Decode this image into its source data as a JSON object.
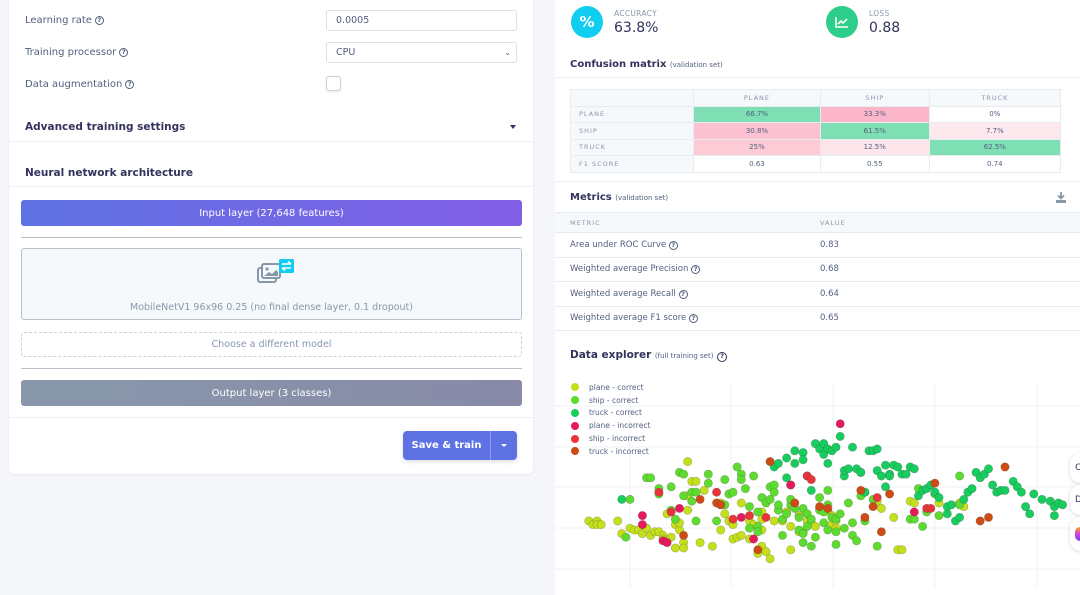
{
  "training_settings": {
    "learning_rate": {
      "label": "Learning rate",
      "value": "0.0005"
    },
    "training_processor": {
      "label": "Training processor",
      "value": "CPU"
    },
    "data_augmentation": {
      "label": "Data augmentation",
      "checked": false
    },
    "help_glyph": "?"
  },
  "advanced": {
    "label": "Advanced training settings"
  },
  "architecture": {
    "title": "Neural network architecture",
    "input_layer": "Input layer (27,648 features)",
    "model_name": "MobileNetV1 96x96 0.25 (no final dense layer, 0.1 dropout)",
    "choose_model": "Choose a different model",
    "output_layer": "Output layer (3 classes)"
  },
  "actions": {
    "save_train": "Save & train"
  },
  "stats": {
    "accuracy": {
      "label": "ACCURACY",
      "value": "63.8%",
      "icon": "percent-icon",
      "color": "#11cdef"
    },
    "loss": {
      "label": "LOSS",
      "value": "0.88",
      "icon": "chart-line-icon",
      "color": "#2dce89"
    }
  },
  "confusion_matrix": {
    "title": "Confusion matrix",
    "subtitle": "(validation set)",
    "columns": [
      "PLANE",
      "SHIP",
      "TRUCK"
    ],
    "rows": [
      {
        "label": "PLANE",
        "cells": [
          "66.7%",
          "33.3%",
          "0%"
        ],
        "colors": [
          "#7ddfb3",
          "#fbb6c9",
          "#ffffff"
        ]
      },
      {
        "label": "SHIP",
        "cells": [
          "30.8%",
          "61.5%",
          "7.7%"
        ],
        "colors": [
          "#fcc2d1",
          "#7ddfb3",
          "#fde9ed"
        ]
      },
      {
        "label": "TRUCK",
        "cells": [
          "25%",
          "12.5%",
          "62.5%"
        ],
        "colors": [
          "#fccbd6",
          "#fde6eb",
          "#7ddfb3"
        ]
      },
      {
        "label": "F1 SCORE",
        "cells": [
          "0.63",
          "0.55",
          "0.74"
        ],
        "colors": [
          "#ffffff",
          "#ffffff",
          "#ffffff"
        ]
      }
    ]
  },
  "metrics": {
    "title": "Metrics",
    "subtitle": "(validation set)",
    "headers": [
      "METRIC",
      "VALUE"
    ],
    "rows": [
      {
        "metric": "Area under ROC Curve",
        "value": "0.83"
      },
      {
        "metric": "Weighted average Precision",
        "value": "0.68"
      },
      {
        "metric": "Weighted average Recall",
        "value": "0.64"
      },
      {
        "metric": "Weighted average F1 score",
        "value": "0.65"
      }
    ]
  },
  "data_explorer": {
    "title": "Data explorer",
    "subtitle": "(full training set)",
    "legend": [
      {
        "label": "plane - correct",
        "color": "#c5e01a"
      },
      {
        "label": "ship - correct",
        "color": "#5ddc2f"
      },
      {
        "label": "truck - correct",
        "color": "#17cd5e"
      },
      {
        "label": "plane - incorrect",
        "color": "#e8195a"
      },
      {
        "label": "ship - incorrect",
        "color": "#e8353a"
      },
      {
        "label": "truck - incorrect",
        "color": "#cf4b16"
      }
    ]
  },
  "chart_data": {
    "type": "scatter",
    "title": "Data explorer (full training set)",
    "xlabel": "",
    "ylabel": "",
    "xlim": [
      0,
      100
    ],
    "ylim": [
      0,
      100
    ],
    "grid": true,
    "legend_position": "top-left",
    "series": [
      {
        "name": "plane - correct",
        "points": [
          [
            7,
            30
          ],
          [
            8,
            28
          ],
          [
            9,
            30
          ],
          [
            9,
            28
          ],
          [
            10,
            28
          ],
          [
            14,
            30
          ],
          [
            15,
            23
          ],
          [
            17,
            26
          ],
          [
            18,
            25
          ],
          [
            19,
            25
          ],
          [
            20,
            23
          ],
          [
            21,
            26
          ],
          [
            22,
            22
          ],
          [
            23,
            24
          ],
          [
            24,
            24
          ],
          [
            25,
            22
          ],
          [
            25,
            20
          ],
          [
            26,
            34
          ],
          [
            27,
            21
          ],
          [
            28,
            15
          ],
          [
            28,
            28
          ],
          [
            29,
            25
          ],
          [
            29,
            29
          ],
          [
            30,
            18
          ],
          [
            30,
            15
          ],
          [
            31,
            36
          ],
          [
            31,
            63
          ],
          [
            31,
            44
          ],
          [
            32,
            52
          ],
          [
            33,
            52
          ],
          [
            34,
            18
          ],
          [
            35,
            47
          ],
          [
            37,
            16
          ],
          [
            39,
            40
          ],
          [
            39,
            25
          ],
          [
            40,
            34
          ],
          [
            41,
            30
          ],
          [
            42,
            28
          ],
          [
            42,
            20
          ],
          [
            43,
            21
          ],
          [
            44,
            22
          ],
          [
            44,
            40
          ],
          [
            46,
            20
          ],
          [
            46,
            30
          ],
          [
            47,
            28
          ],
          [
            48,
            12
          ],
          [
            49,
            35
          ],
          [
            49,
            31
          ],
          [
            49,
            16
          ],
          [
            49,
            25
          ],
          [
            50,
            13
          ],
          [
            51,
            9
          ],
          [
            52,
            30
          ],
          [
            54,
            30
          ],
          [
            55,
            35
          ],
          [
            56,
            27
          ],
          [
            56,
            14
          ],
          [
            56,
            50
          ],
          [
            58,
            24
          ],
          [
            58,
            33
          ],
          [
            59,
            24
          ],
          [
            60,
            30
          ],
          [
            61,
            29
          ],
          [
            62,
            27
          ],
          [
            63,
            37
          ],
          [
            65,
            36
          ],
          [
            66,
            33
          ],
          [
            66,
            28
          ],
          [
            67,
            26
          ],
          [
            67,
            30
          ],
          [
            73,
            57
          ],
          [
            74,
            46
          ],
          [
            77,
            41
          ],
          [
            78,
            37
          ],
          [
            81,
            32
          ],
          [
            82,
            14
          ],
          [
            83,
            14
          ],
          [
            85,
            41
          ],
          [
            86,
            40
          ],
          [
            92,
            40
          ],
          [
            98,
            38
          ],
          [
            97,
            40
          ]
        ]
      },
      {
        "name": "ship - correct",
        "points": [
          [
            16,
            21
          ],
          [
            17,
            42
          ],
          [
            21,
            54
          ],
          [
            22,
            54
          ],
          [
            24,
            48
          ],
          [
            24,
            45
          ],
          [
            27,
            49
          ],
          [
            27,
            36
          ],
          [
            28,
            31
          ],
          [
            29,
            57
          ],
          [
            30,
            44
          ],
          [
            30,
            56
          ],
          [
            32,
            41
          ],
          [
            32,
            46
          ],
          [
            33,
            46
          ],
          [
            33,
            30
          ],
          [
            36,
            56
          ],
          [
            36,
            51
          ],
          [
            38,
            30
          ],
          [
            39,
            39
          ],
          [
            40,
            39
          ],
          [
            40,
            53
          ],
          [
            41,
            45
          ],
          [
            42,
            46
          ],
          [
            43,
            60
          ],
          [
            44,
            56
          ],
          [
            44,
            53
          ],
          [
            45,
            48
          ],
          [
            46,
            38
          ],
          [
            46,
            26
          ],
          [
            47,
            55
          ],
          [
            48,
            35
          ],
          [
            48,
            27
          ],
          [
            48,
            24
          ],
          [
            49,
            43
          ],
          [
            50,
            40
          ],
          [
            51,
            42
          ],
          [
            51,
            49
          ],
          [
            52,
            50
          ],
          [
            52,
            46
          ],
          [
            53,
            36
          ],
          [
            53,
            39
          ],
          [
            54,
            22
          ],
          [
            54,
            31
          ],
          [
            55,
            34
          ],
          [
            56,
            39
          ],
          [
            56,
            42
          ],
          [
            57,
            37
          ],
          [
            58,
            32
          ],
          [
            58,
            25
          ],
          [
            59,
            18
          ],
          [
            59,
            23
          ],
          [
            59,
            37
          ],
          [
            60,
            34
          ],
          [
            60,
            27
          ],
          [
            61,
            16
          ],
          [
            61,
            31
          ],
          [
            62,
            21
          ],
          [
            63,
            43
          ],
          [
            63,
            36
          ],
          [
            64,
            29
          ],
          [
            64,
            35
          ],
          [
            65,
            47
          ],
          [
            65,
            39
          ],
          [
            65,
            25
          ],
          [
            66,
            32
          ],
          [
            67,
            31
          ],
          [
            67,
            17
          ],
          [
            67,
            24
          ],
          [
            68,
            34
          ],
          [
            69,
            26
          ],
          [
            70,
            40
          ],
          [
            71,
            29
          ],
          [
            71,
            22
          ],
          [
            72,
            19
          ],
          [
            73,
            44
          ],
          [
            74,
            30
          ],
          [
            76,
            42
          ],
          [
            77,
            16
          ],
          [
            85,
            31
          ],
          [
            86,
            31
          ],
          [
            87,
            48
          ],
          [
            88,
            27
          ],
          [
            89,
            35
          ],
          [
            91,
            45
          ],
          [
            92,
            33
          ],
          [
            97,
            39
          ],
          [
            97,
            55
          ]
        ]
      },
      {
        "name": "truck - correct",
        "points": [
          [
            15,
            42
          ],
          [
            52,
            60
          ],
          [
            53,
            62
          ],
          [
            55,
            54
          ],
          [
            55,
            65
          ],
          [
            57,
            62
          ],
          [
            57,
            69
          ],
          [
            59,
            68
          ],
          [
            59,
            64
          ],
          [
            60,
            55
          ],
          [
            61,
            47
          ],
          [
            62,
            73
          ],
          [
            63,
            70
          ],
          [
            64,
            73
          ],
          [
            64,
            67
          ],
          [
            65,
            62
          ],
          [
            65,
            70
          ],
          [
            66,
            69
          ],
          [
            67,
            71
          ],
          [
            68,
            77
          ],
          [
            69,
            55
          ],
          [
            69,
            58
          ],
          [
            70,
            59
          ],
          [
            71,
            71
          ],
          [
            72,
            59
          ],
          [
            73,
            57
          ],
          [
            74,
            46
          ],
          [
            75,
            69
          ],
          [
            76,
            69
          ],
          [
            77,
            70
          ],
          [
            77,
            58
          ],
          [
            78,
            55
          ],
          [
            79,
            49
          ],
          [
            79,
            61
          ],
          [
            80,
            56
          ],
          [
            80,
            55
          ],
          [
            81,
            61
          ],
          [
            82,
            60
          ],
          [
            83,
            56
          ],
          [
            84,
            56
          ],
          [
            85,
            60
          ],
          [
            86,
            59
          ],
          [
            87,
            44
          ],
          [
            88,
            47
          ],
          [
            89,
            48
          ],
          [
            90,
            50
          ],
          [
            91,
            46
          ],
          [
            92,
            43
          ],
          [
            94,
            34
          ],
          [
            94,
            38
          ],
          [
            95,
            39
          ],
          [
            96,
            30
          ],
          [
            97,
            32
          ],
          [
            98,
            42
          ],
          [
            99,
            46
          ],
          [
            100,
            48
          ],
          [
            101,
            57
          ],
          [
            102,
            54
          ],
          [
            103,
            56
          ],
          [
            104,
            59
          ],
          [
            105,
            50
          ],
          [
            106,
            46
          ],
          [
            107,
            47
          ],
          [
            108,
            47
          ],
          [
            110,
            52
          ],
          [
            111,
            49
          ],
          [
            112,
            46
          ],
          [
            113,
            38
          ],
          [
            114,
            34
          ],
          [
            115,
            45
          ],
          [
            117,
            42
          ],
          [
            119,
            41
          ],
          [
            120,
            38
          ],
          [
            121,
            40
          ],
          [
            120,
            33
          ],
          [
            122,
            39
          ]
        ]
      },
      {
        "name": "plane - incorrect",
        "points": [
          [
            20,
            33
          ],
          [
            20,
            28
          ],
          [
            25,
            19
          ],
          [
            26,
            18
          ],
          [
            29,
            37
          ],
          [
            44,
            32
          ],
          [
            47,
            20
          ],
          [
            56,
            50
          ],
          [
            68,
            84
          ],
          [
            86,
            35
          ]
        ]
      },
      {
        "name": "ship - incorrect",
        "points": [
          [
            24,
            46
          ],
          [
            27,
            35
          ],
          [
            38,
            46
          ],
          [
            42,
            31
          ],
          [
            46,
            33
          ],
          [
            50,
            32
          ],
          [
            60,
            55
          ],
          [
            61,
            53
          ],
          [
            77,
            43
          ],
          [
            89,
            37
          ],
          [
            90,
            37
          ]
        ]
      },
      {
        "name": "truck - incorrect",
        "points": [
          [
            30,
            22
          ],
          [
            34,
            42
          ],
          [
            38,
            40
          ],
          [
            39,
            39
          ],
          [
            48,
            14
          ],
          [
            51,
            63
          ],
          [
            57,
            40
          ],
          [
            63,
            38
          ],
          [
            65,
            37
          ],
          [
            73,
            47
          ],
          [
            74,
            32
          ],
          [
            76,
            38
          ],
          [
            78,
            24
          ],
          [
            80,
            45
          ],
          [
            91,
            51
          ],
          [
            102,
            30
          ],
          [
            104,
            32
          ],
          [
            108,
            60
          ]
        ]
      }
    ]
  },
  "side_float": [
    "C",
    "D"
  ]
}
